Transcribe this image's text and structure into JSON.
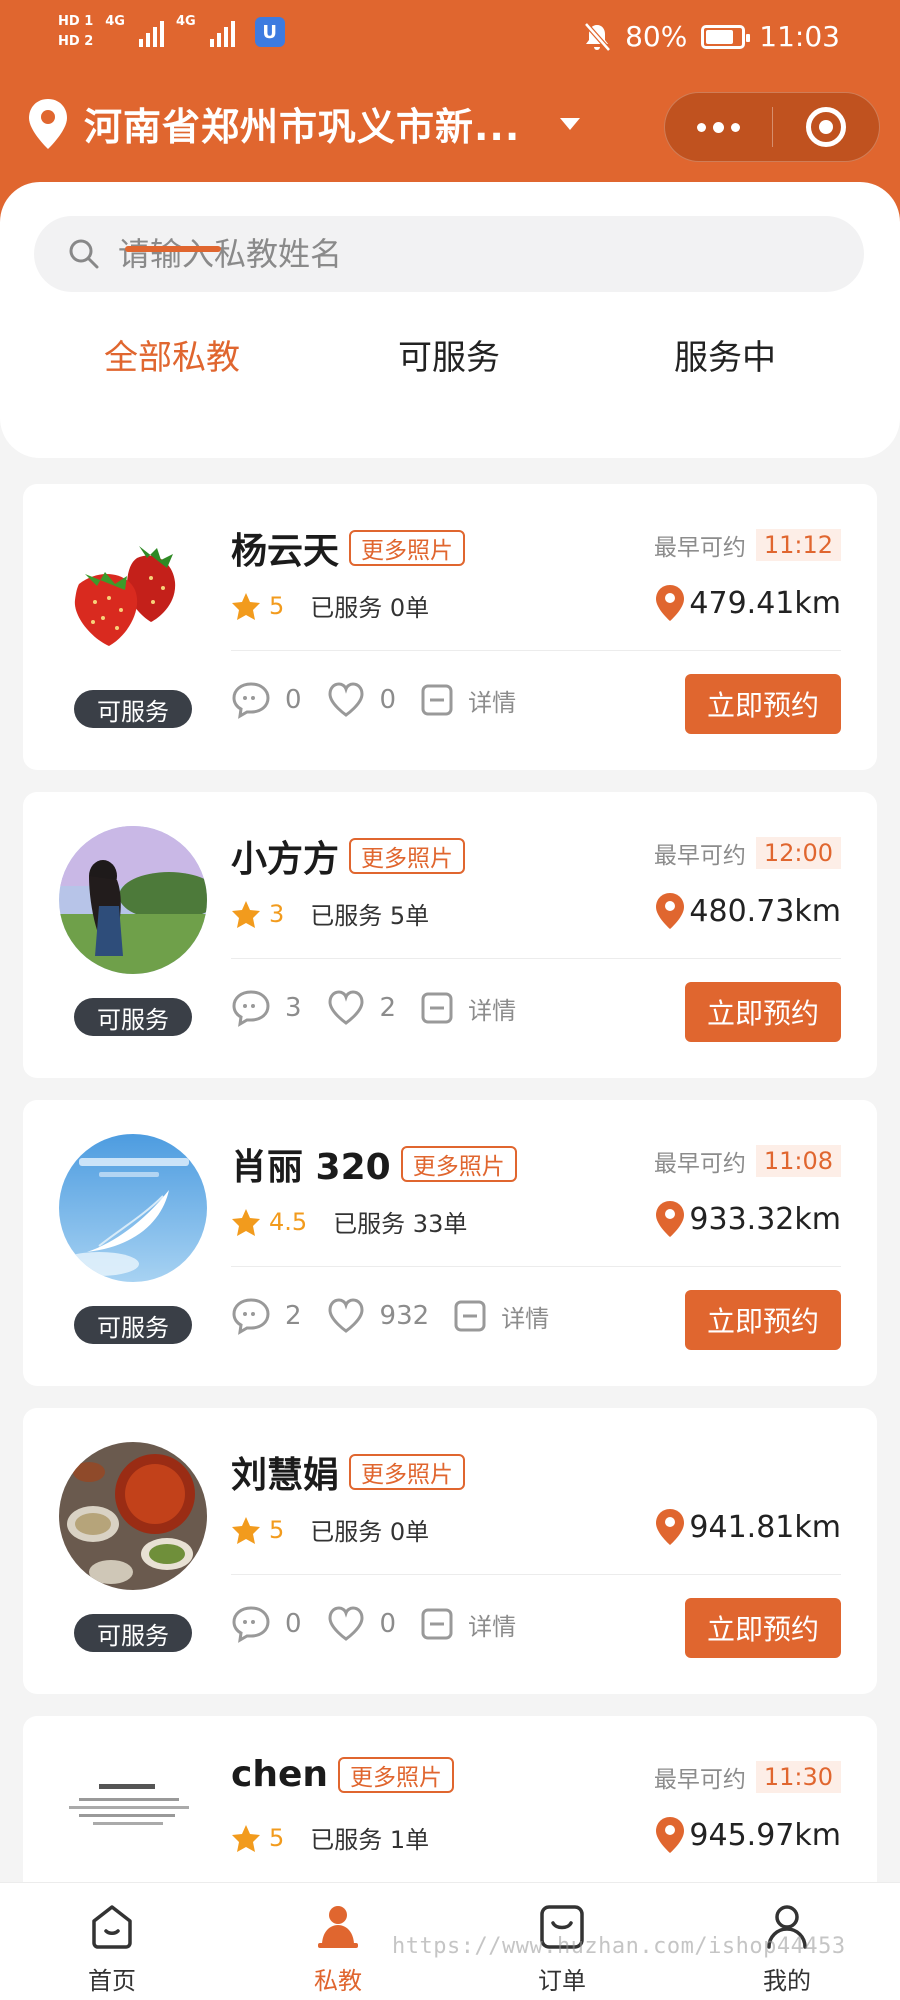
{
  "status_bar": {
    "hd1": "HD 1",
    "hd2": "HD 2",
    "net1": "4G",
    "net2": "4G",
    "app_badge": "U",
    "battery": "80%",
    "time": "11:03"
  },
  "header": {
    "location": "河南省郑州市巩义市新...",
    "accent_color": "#e0662f"
  },
  "search": {
    "placeholder": "请输入私教姓名"
  },
  "tabs": [
    {
      "label": "全部私教",
      "active": true
    },
    {
      "label": "可服务",
      "active": false
    },
    {
      "label": "服务中",
      "active": false
    }
  ],
  "labels": {
    "more_photos": "更多照片",
    "earliest": "最早可约",
    "detail": "详情",
    "book": "立即预约"
  },
  "coaches": [
    {
      "name": "杨云天",
      "status": "可服务",
      "rating": "5",
      "served": "已服务 0单",
      "earliest_time": "11:12",
      "distance": "479.41km",
      "comments": "0",
      "likes": "0",
      "avatar": "strawberry"
    },
    {
      "name": "小方方",
      "status": "可服务",
      "rating": "3",
      "served": "已服务 5单",
      "earliest_time": "12:00",
      "distance": "480.73km",
      "comments": "3",
      "likes": "2",
      "avatar": "girl-in-field"
    },
    {
      "name": "肖丽 320",
      "status": "可服务",
      "rating": "4.5",
      "served": "已服务 33单",
      "earliest_time": "11:08",
      "distance": "933.32km",
      "comments": "2",
      "likes": "932",
      "avatar": "sky-feather"
    },
    {
      "name": "刘慧娟",
      "status": "可服务",
      "rating": "5",
      "served": "已服务 0单",
      "earliest_time": "",
      "distance": "941.81km",
      "comments": "0",
      "likes": "0",
      "avatar": "hotpot"
    },
    {
      "name": "chen",
      "status": "",
      "rating": "5",
      "served": "已服务 1单",
      "earliest_time": "11:30",
      "distance": "945.97km",
      "comments": "",
      "likes": "",
      "avatar": "text-note"
    }
  ],
  "tabbar": [
    {
      "label": "首页",
      "icon": "home-icon",
      "active": false
    },
    {
      "label": "私教",
      "icon": "coach-icon",
      "active": true
    },
    {
      "label": "订单",
      "icon": "order-icon",
      "active": false
    },
    {
      "label": "我的",
      "icon": "profile-icon",
      "active": false
    }
  ],
  "watermark": "https://www.huzhan.com/ishop44453"
}
